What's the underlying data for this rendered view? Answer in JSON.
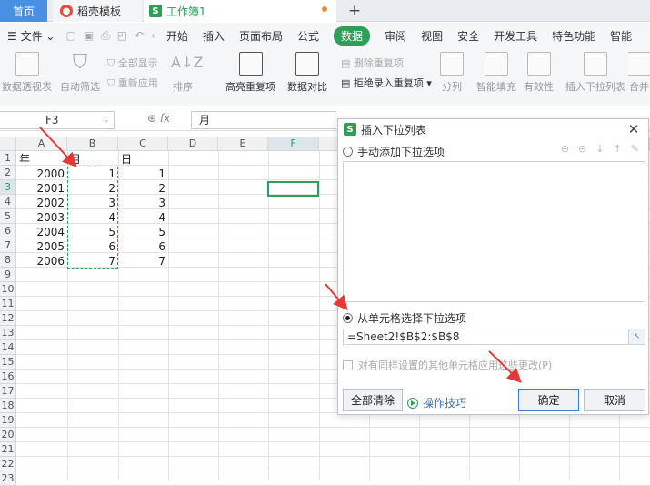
{
  "tabs": {
    "home": "首页",
    "daoke": "稻壳模板",
    "workbook": "工作簿1",
    "daoke_badge": "●",
    "workbook_badge": "S"
  },
  "menu": {
    "file": "文件",
    "items": [
      "开始",
      "插入",
      "页面布局",
      "公式",
      "数据",
      "审阅",
      "视图",
      "安全",
      "开发工具",
      "特色功能",
      "智能"
    ],
    "active": "数据"
  },
  "ribbon": {
    "pivot": "数据透视表",
    "autofilter": "自动筛选",
    "showall": "全部显示",
    "reapply": "重新应用",
    "sort": "排序",
    "highlight_dup": "高亮重复项",
    "compare": "数据对比",
    "remove_dup": "删除重复项",
    "reject_dup": "拒绝录入重复项",
    "split": "分列",
    "smart_fill": "智能填充",
    "validity": "有效性",
    "insert_dropdown": "插入下拉列表",
    "merge": "合并"
  },
  "formula_bar": {
    "cell_ref": "F3",
    "fx": "fx",
    "content": "月"
  },
  "columns": [
    "A",
    "B",
    "C",
    "D",
    "E",
    "F"
  ],
  "rows": [
    "1",
    "2",
    "3",
    "4",
    "5",
    "6",
    "7",
    "8",
    "9",
    "10",
    "11",
    "12",
    "13",
    "14",
    "15",
    "16",
    "17",
    "18",
    "19",
    "20",
    "21",
    "22",
    "23"
  ],
  "cells": {
    "header": [
      "年",
      "月",
      "日"
    ],
    "years": [
      "2000",
      "2001",
      "2002",
      "2003",
      "2004",
      "2005",
      "2006"
    ],
    "months": [
      "1",
      "2",
      "3",
      "4",
      "5",
      "6",
      "7"
    ],
    "days": [
      "1",
      "2",
      "3",
      "4",
      "5",
      "6",
      "7"
    ]
  },
  "dialog": {
    "title": "插入下拉列表",
    "opt_manual": "手动添加下拉选项",
    "opt_from_cells": "从单元格选择下拉选项",
    "source": "=Sheet2!$B$2:$B$8",
    "apply_all": "对有同样设置的其他单元格应用这些更改(P)",
    "clear_all": "全部清除",
    "tips": "操作技巧",
    "ok": "确定",
    "cancel": "取消"
  },
  "colors": {
    "accent": "#2f9e57",
    "annotation": "#e53935",
    "home_tab": "#4a90e2"
  }
}
